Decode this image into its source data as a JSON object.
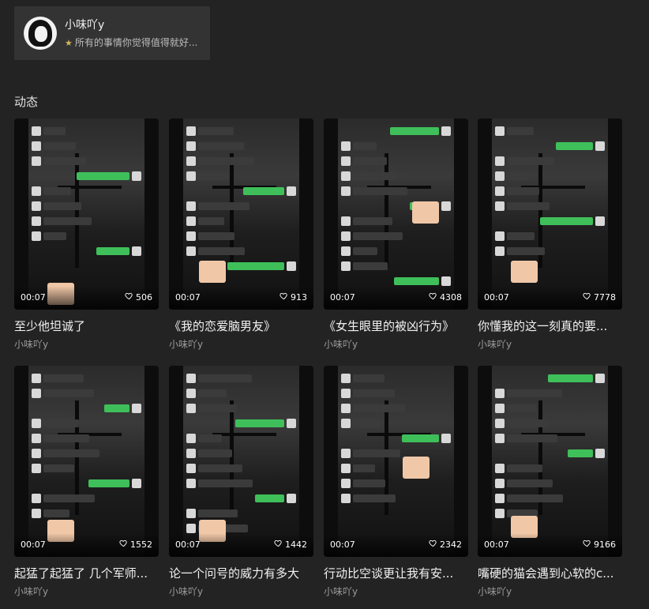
{
  "profile": {
    "name": "小味吖y",
    "signature": "所有的事情你觉得值得就好...",
    "star_glyph": "★"
  },
  "section_title": "动态",
  "videos": [
    {
      "duration": "00:07",
      "likes": "506",
      "title": "至少他坦诚了",
      "author": "小味吖y"
    },
    {
      "duration": "00:07",
      "likes": "913",
      "title": "《我的恋爱脑男友》",
      "author": "小味吖y"
    },
    {
      "duration": "00:07",
      "likes": "4308",
      "title": "《女生眼里的被凶行为》",
      "author": "小味吖y"
    },
    {
      "duration": "00:07",
      "likes": "7778",
      "title": "你懂我的这一刻真的要...",
      "author": "小味吖y"
    },
    {
      "duration": "00:07",
      "likes": "1552",
      "title": "起猛了起猛了 几个军师...",
      "author": "小味吖y"
    },
    {
      "duration": "00:07",
      "likes": "1442",
      "title": "论一个问号的威力有多大",
      "author": "小味吖y"
    },
    {
      "duration": "00:07",
      "likes": "2342",
      "title": "行动比空谈更让我有安...",
      "author": "小味吖y"
    },
    {
      "duration": "00:07",
      "likes": "9166",
      "title": "嘴硬的猫会遇到心软的c...",
      "author": "小味吖y"
    }
  ],
  "colors": {
    "background": "#232323",
    "card": "#333333",
    "bubble_green": "#3fbf5a",
    "author_text": "#9a9a9a"
  },
  "icons": [
    "star-icon",
    "heart-icon"
  ]
}
